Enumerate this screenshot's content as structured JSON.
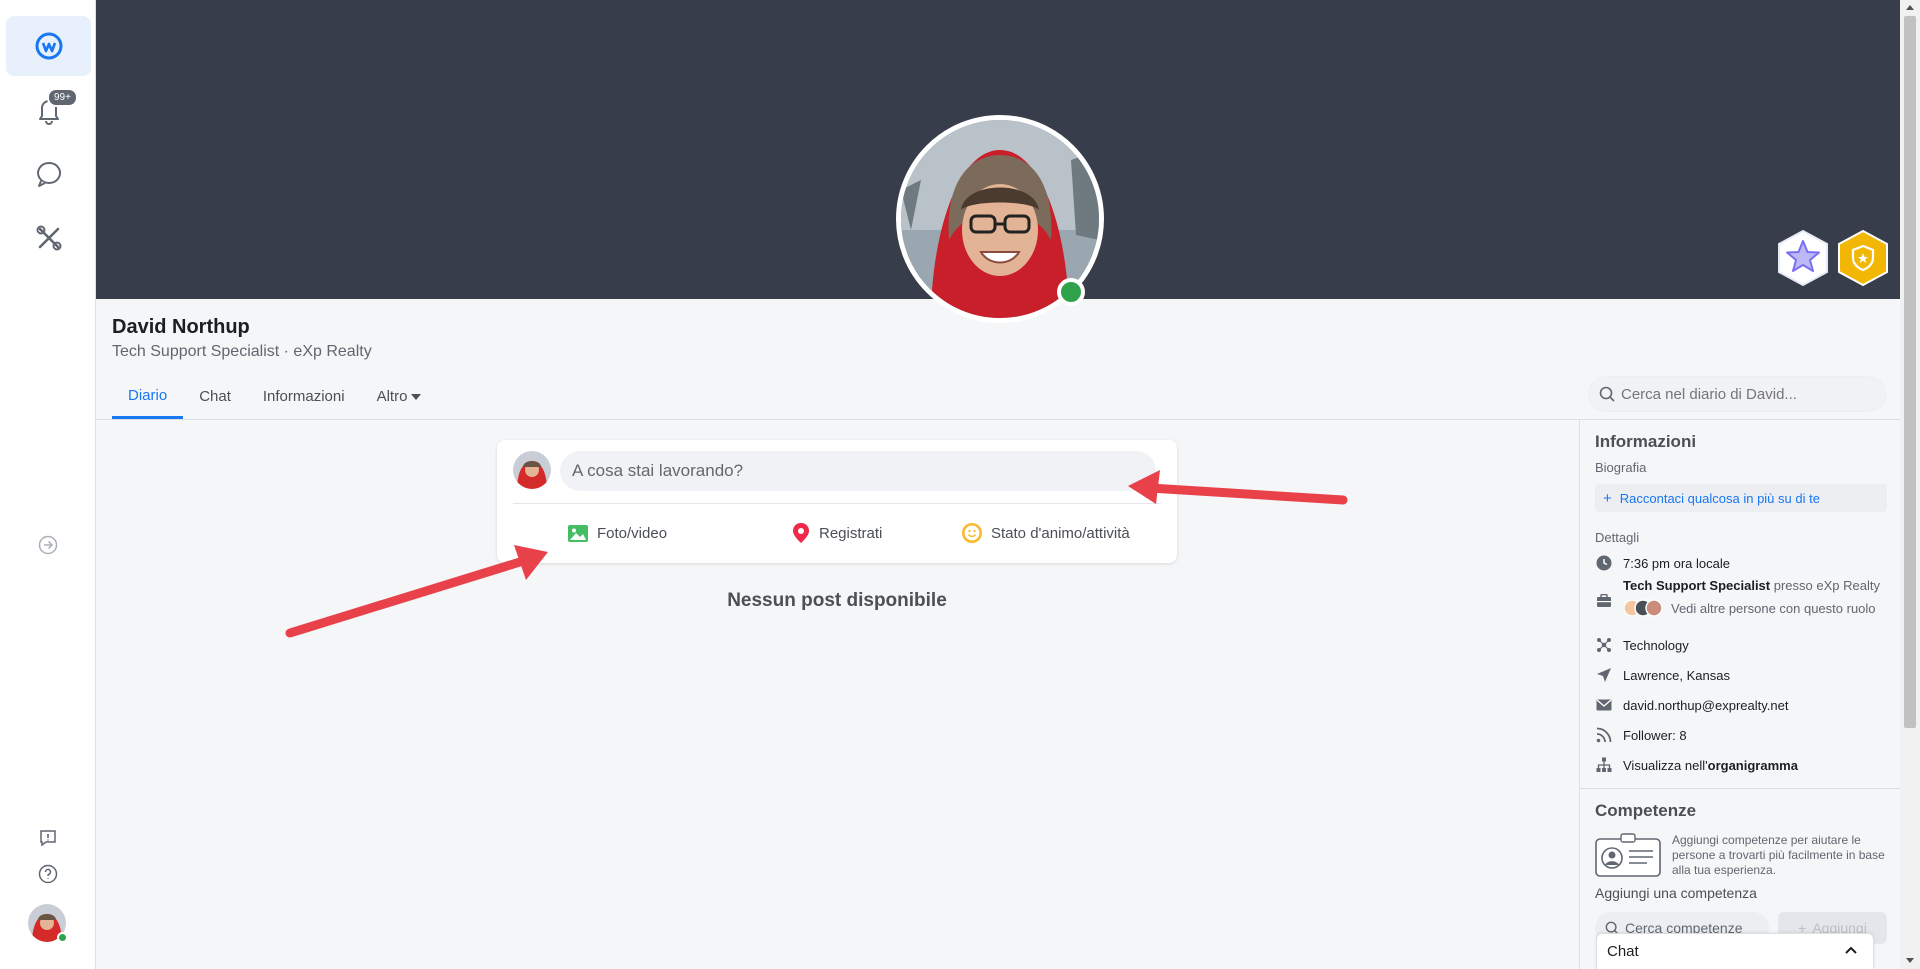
{
  "rail": {
    "notifications_badge": "99+"
  },
  "profile": {
    "name": "David Northup",
    "subtitle": "Tech Support Specialist · eXp Realty"
  },
  "tabs": [
    {
      "label": "Diario"
    },
    {
      "label": "Chat"
    },
    {
      "label": "Informazioni"
    },
    {
      "label": "Altro"
    }
  ],
  "search": {
    "placeholder": "Cerca nel diario di David..."
  },
  "composer": {
    "placeholder": "A cosa stai lavorando?",
    "actions": {
      "photo": "Foto/video",
      "checkin": "Registrati",
      "feeling": "Stato d'animo/attività"
    }
  },
  "feed": {
    "empty": "Nessun post disponibile"
  },
  "info": {
    "title": "Informazioni",
    "bio_label": "Biografia",
    "bio_add": "Raccontaci qualcosa in più su di te",
    "details_label": "Dettagli",
    "local_time": "7:36 pm ora locale",
    "role_title": "Tech Support Specialist",
    "role_at": " presso ",
    "role_company": "eXp Realty",
    "role_others": "Vedi altre persone con questo ruolo",
    "industry": "Technology",
    "location": "Lawrence, Kansas",
    "email": "david.northup@exprealty.net",
    "followers": "Follower: 8",
    "org_prefix": "Visualizza nell'",
    "org_link": "organigramma"
  },
  "skills": {
    "title": "Competenze",
    "help_text": "Aggiungi competenze per aiutare le persone a trovarti più facilmente in base alla tua esperienza.",
    "add_label": "Aggiungi una competenza",
    "search_placeholder": "Cerca competenze",
    "add_button": "Aggiungi"
  },
  "chat_dock": {
    "label": "Chat"
  },
  "colors": {
    "accent": "#1877f2",
    "cover": "#373d4a",
    "online": "#31a24c",
    "annotation_arrow": "#e8414a"
  }
}
